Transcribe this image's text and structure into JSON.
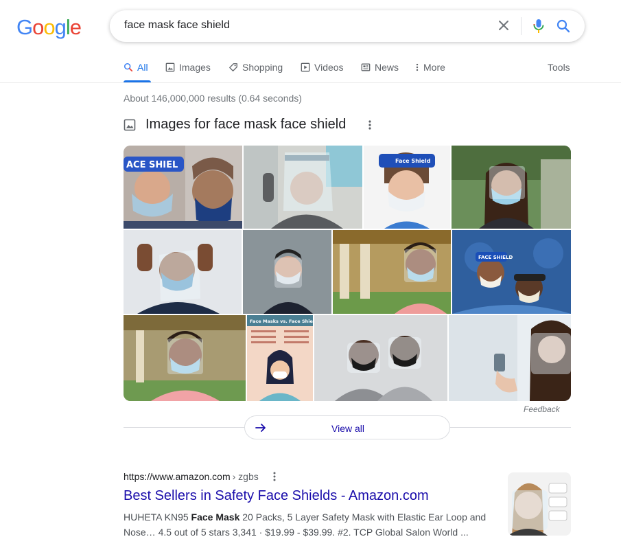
{
  "logo": {
    "letters": [
      "G",
      "o",
      "o",
      "g",
      "l",
      "e"
    ],
    "colors": [
      "#4285F4",
      "#EA4335",
      "#FBBC05",
      "#4285F4",
      "#34A853",
      "#EA4335"
    ]
  },
  "search": {
    "query": "face mask face shield",
    "clear_icon": "close-icon",
    "mic_icon": "mic-icon",
    "search_icon": "search-icon"
  },
  "tabs": [
    {
      "label": "All",
      "icon": "search-icon",
      "active": true
    },
    {
      "label": "Images",
      "icon": "image-icon"
    },
    {
      "label": "Shopping",
      "icon": "tag-icon"
    },
    {
      "label": "Videos",
      "icon": "play-icon"
    },
    {
      "label": "News",
      "icon": "newspaper-icon"
    },
    {
      "label": "More",
      "icon": "kebab-icon"
    }
  ],
  "tools_label": "Tools",
  "stats": "About 146,000,000 results (0.64 seconds)",
  "images_section": {
    "title": "Images for face mask face shield",
    "feedback": "Feedback",
    "view_all": "View all"
  },
  "result": {
    "url": "https://www.amazon.com",
    "breadcrumb": "› zgbs",
    "title": "Best Sellers in Safety Face Shields - Amazon.com",
    "snippet_1": "HUHETA KN95 ",
    "snippet_bold_1": "Face Mask",
    "snippet_2": " 20 Packs, 5 Layer Safety Mask with Elastic Ear Loop and Nose… 4.5 out of 5 stars 3,341 · $19.99 - $39.99. #2. TCP Global Salon World ..."
  },
  "accent_colors": {
    "link": "#1a0dab",
    "active_tab": "#1a73e8",
    "muted": "#70757a"
  }
}
